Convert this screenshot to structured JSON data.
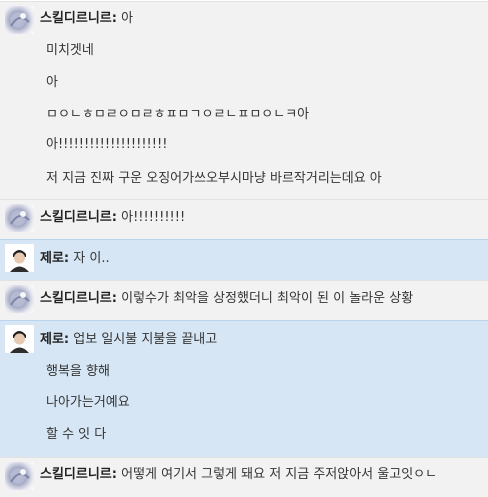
{
  "colors": {
    "skill_row_bg": "#f2f2f2",
    "zero_row_bg": "#d6e6f5",
    "divider": "#e2e2e2"
  },
  "icons": {
    "skill_avatar": "avatar-icon",
    "zero_avatar": "avatar-icon"
  },
  "messages": [
    {
      "author": "스킬디르니르:",
      "text": "아",
      "continuations": [
        "미치겟네",
        "아",
        "ㅁㅇㄴㅎㅁㄹㅇㅁㄹㅎㅍㅁㄱㅇㄹㄴㅍㅁㅇㄴㅋ아",
        "아!!!!!!!!!!!!!!!!!!!!!",
        "저 지금 진짜 구운 오징어가쓰오부시마냥 바르작거리는데요 아"
      ]
    },
    {
      "author": "스킬디르니르:",
      "text": "아!!!!!!!!!!",
      "continuations": []
    },
    {
      "author": "제로:",
      "text": "자 이..",
      "continuations": []
    },
    {
      "author": "스킬디르니르:",
      "text": "이렇수가 최악을 상정했더니 최악이 된 이 놀라운 상황",
      "continuations": []
    },
    {
      "author": "제로:",
      "text": "업보 일시불 지불을 끝내고",
      "continuations": [
        "행복을 향해",
        "나아가는거예요",
        "할 수 잇 다"
      ]
    },
    {
      "author": "스킬디르니르:",
      "text": "어떻게 여기서 그렇게 돼요 저 지금 주저앉아서 울고잇ㅇㄴ",
      "continuations": []
    }
  ]
}
